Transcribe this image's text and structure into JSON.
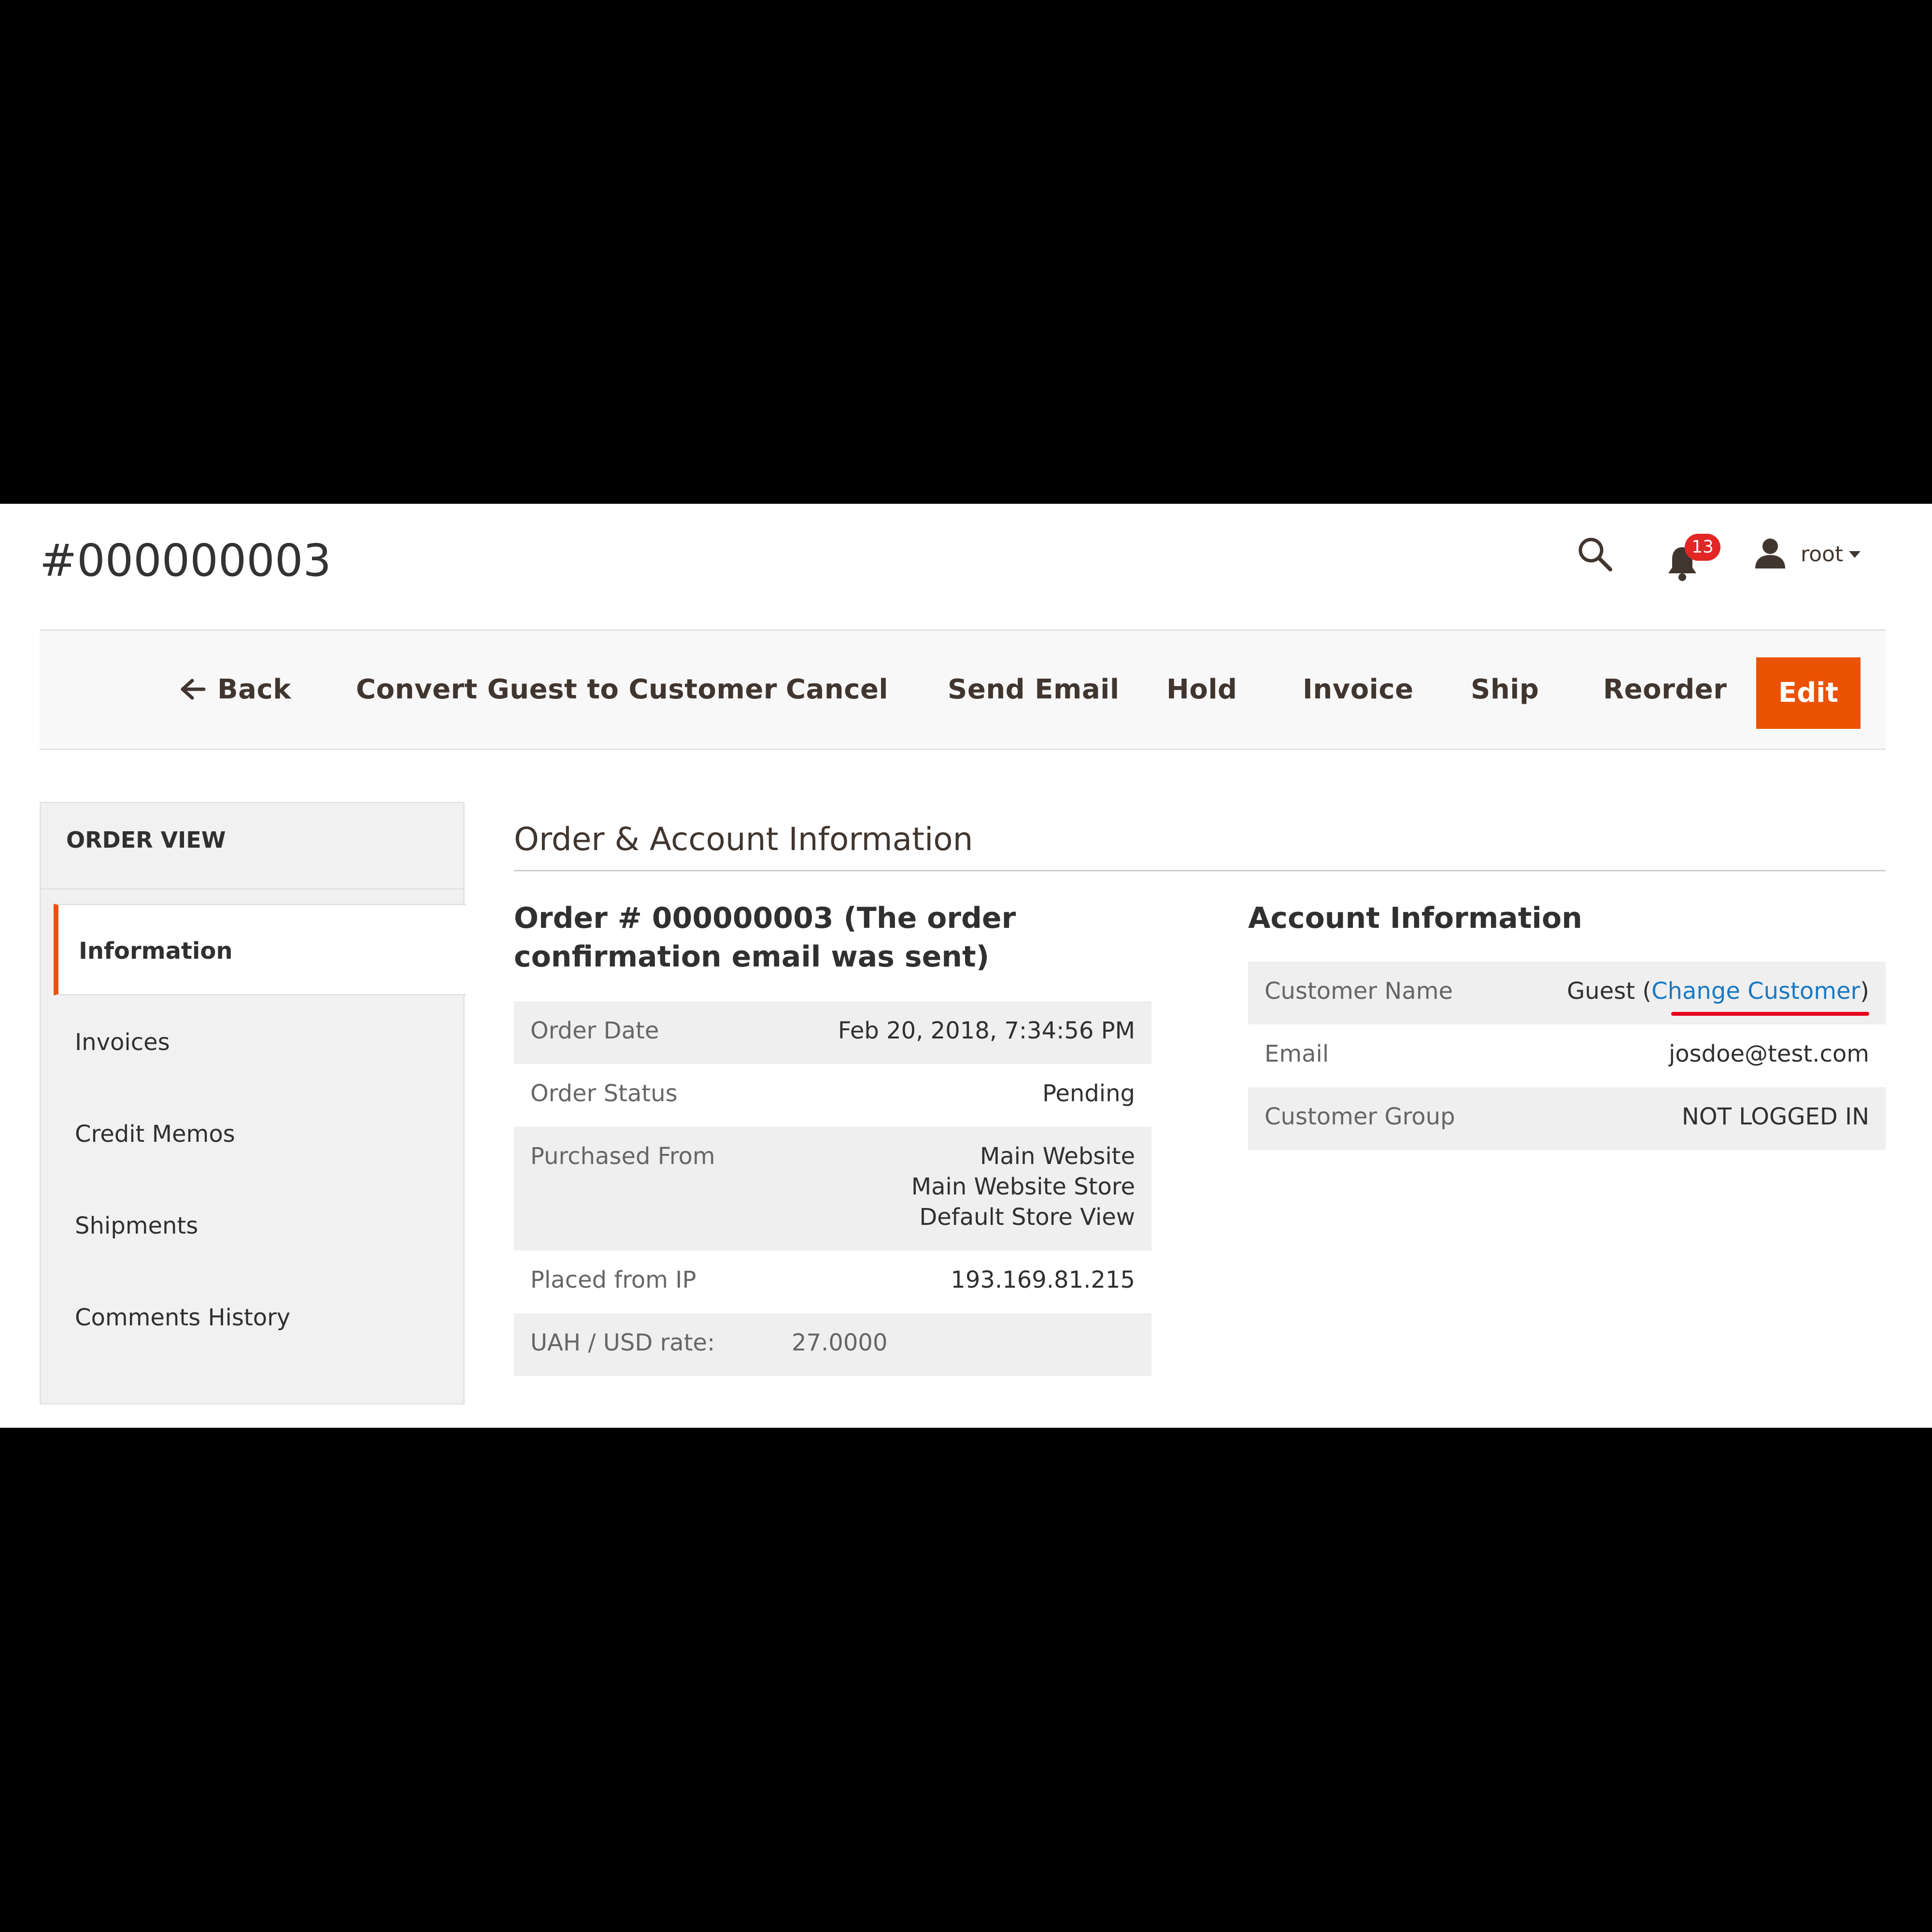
{
  "header": {
    "title": "#000000003",
    "notifications_count": "13",
    "user_name": "root"
  },
  "toolbar": {
    "back_label": "Back",
    "convert_label": "Convert Guest to Customer",
    "cancel_label": "Cancel",
    "send_email_label": "Send Email",
    "hold_label": "Hold",
    "invoice_label": "Invoice",
    "ship_label": "Ship",
    "reorder_label": "Reorder",
    "edit_label": "Edit"
  },
  "sidebar": {
    "title": "ORDER VIEW",
    "items": [
      {
        "label": "Information"
      },
      {
        "label": "Invoices"
      },
      {
        "label": "Credit Memos"
      },
      {
        "label": "Shipments"
      },
      {
        "label": "Comments History"
      }
    ]
  },
  "main": {
    "section_title": "Order & Account Information",
    "order": {
      "heading": "Order # 000000003 (The order confirmation email was sent)",
      "rows": {
        "order_date_label": "Order Date",
        "order_date_value": "Feb 20, 2018, 7:34:56 PM",
        "order_status_label": "Order Status",
        "order_status_value": "Pending",
        "purchased_from_label": "Purchased From",
        "purchased_from_line1": "Main Website",
        "purchased_from_line2": "Main Website Store",
        "purchased_from_line3": "Default Store View",
        "placed_ip_label": "Placed from IP",
        "placed_ip_value": "193.169.81.215",
        "rate_label": "UAH / USD rate:",
        "rate_value": "27.0000"
      }
    },
    "account": {
      "heading": "Account Information",
      "customer_name_label": "Customer Name",
      "customer_name_value": "Guest",
      "change_customer_link": "Change Customer",
      "email_label": "Email",
      "email_value": "josdoe@test.com",
      "group_label": "Customer Group",
      "group_value": "NOT LOGGED IN"
    }
  },
  "colors": {
    "accent": "#eb5202",
    "link": "#1979c3",
    "badge": "#e22626",
    "annotation_underline": "#e8001c"
  },
  "icons": {
    "search": "search-icon",
    "bell": "bell-icon",
    "user": "user-icon",
    "back_arrow": "arrow-left-icon",
    "caret": "caret-down-icon"
  }
}
